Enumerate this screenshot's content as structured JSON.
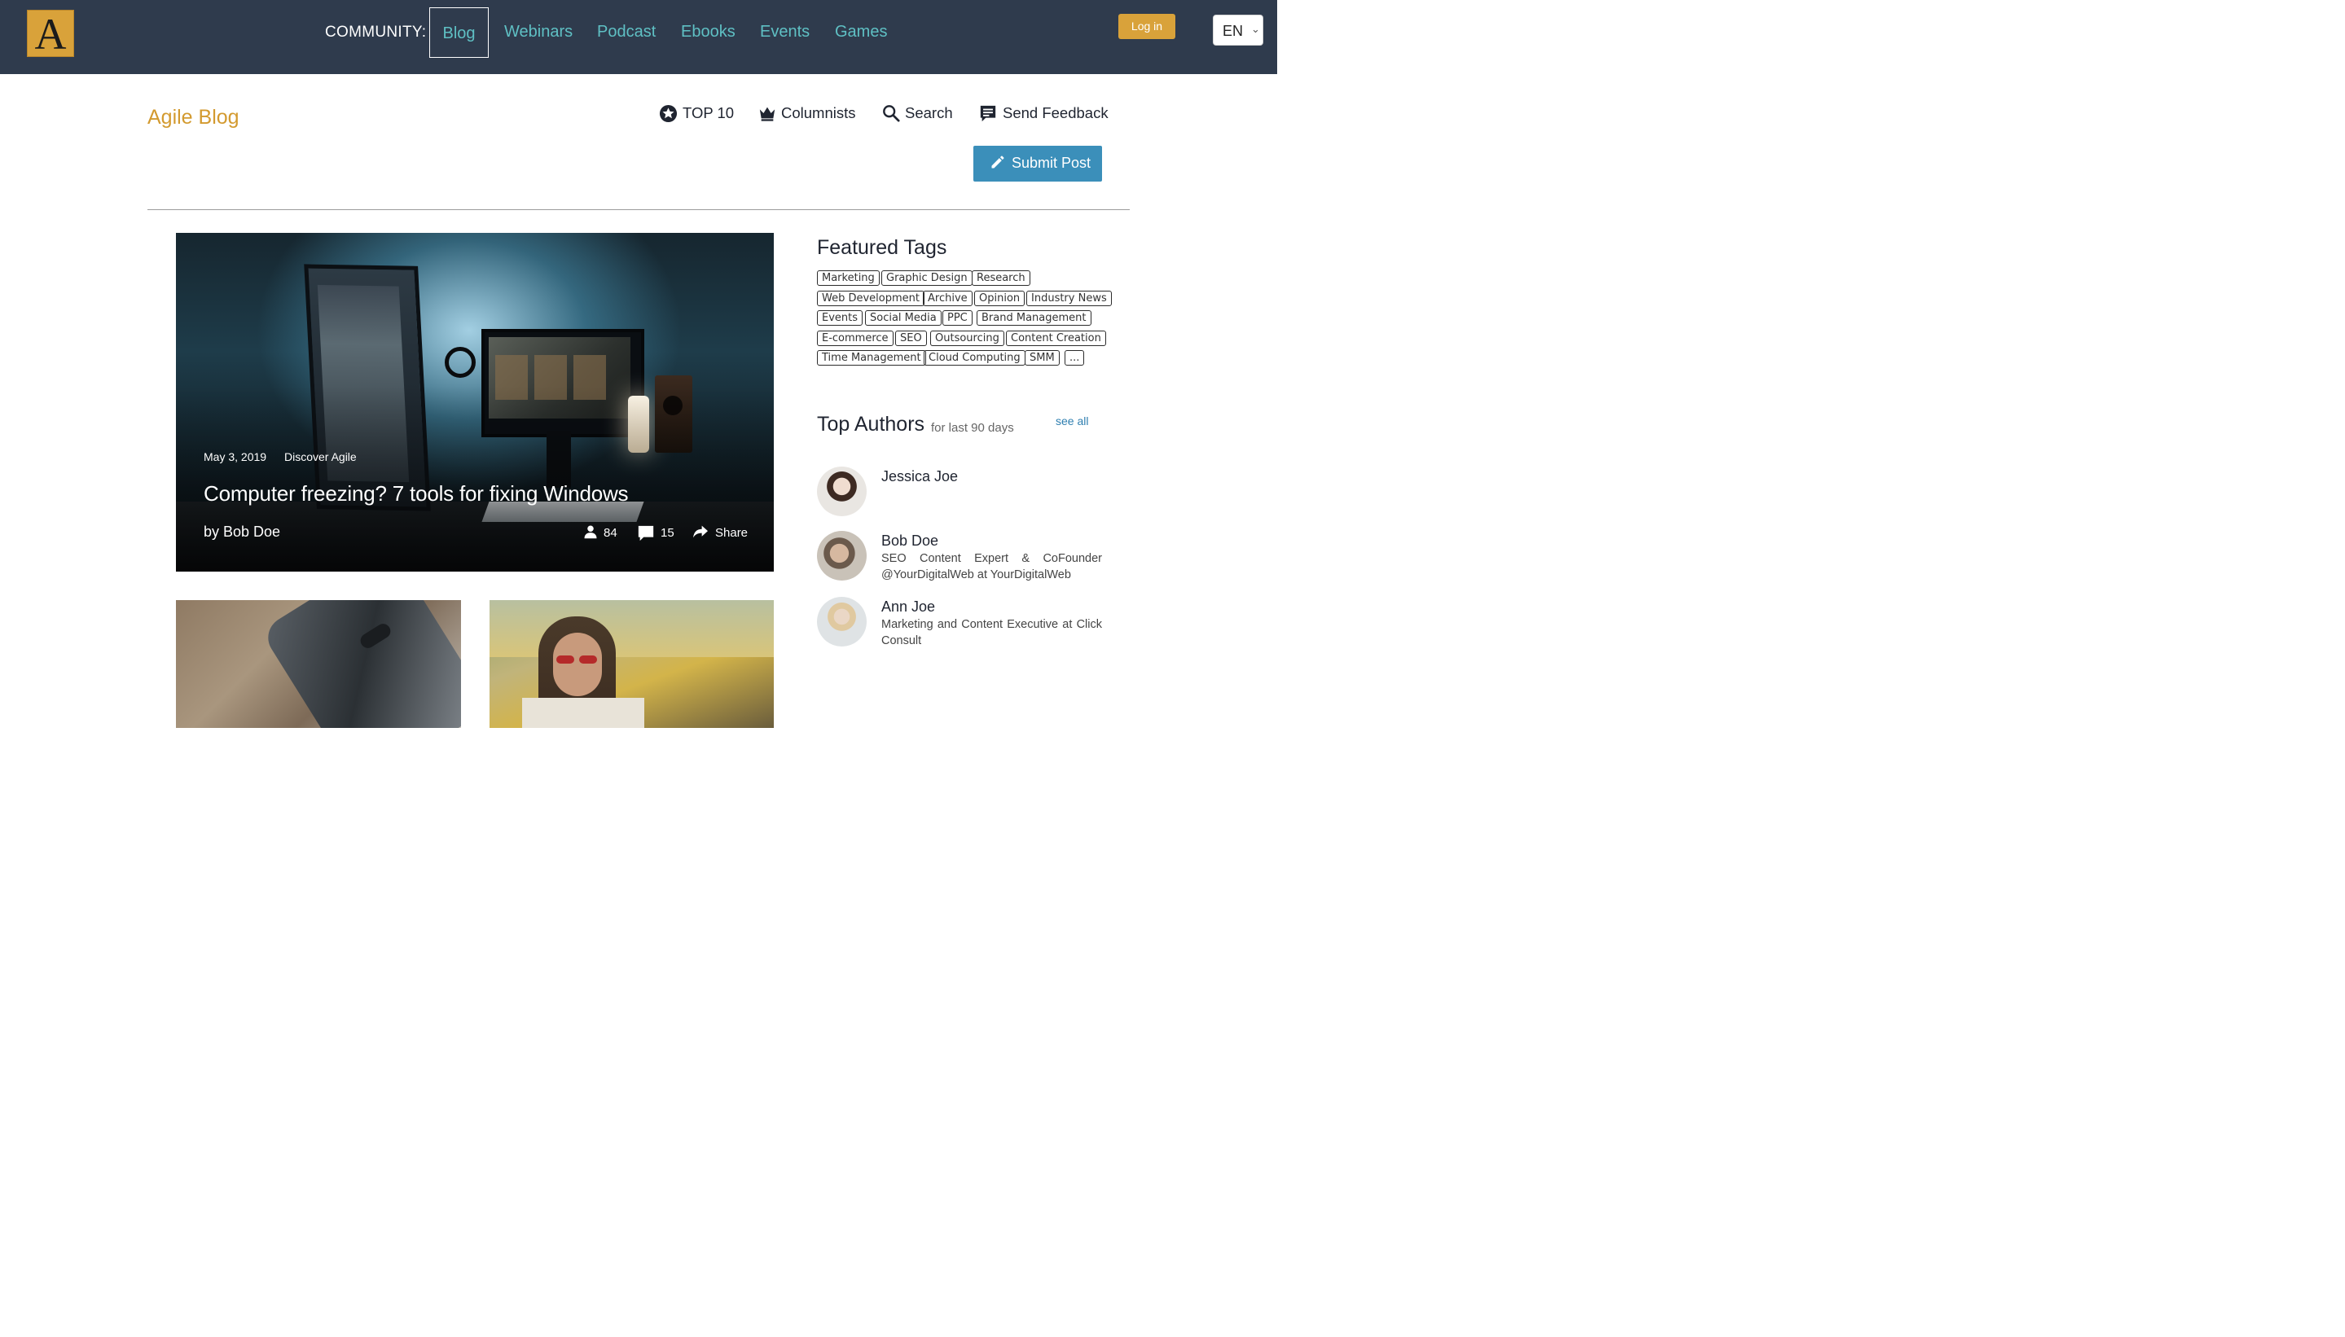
{
  "header": {
    "logo_letter": "A",
    "community_label": "COMMUNITY:",
    "nav": [
      "Blog",
      "Webinars",
      "Podcast",
      "Ebooks",
      "Events",
      "Games"
    ],
    "active_nav": "Blog",
    "login_label": "Log in",
    "language": "EN"
  },
  "blog": {
    "title": "Agile Blog",
    "tools": {
      "top10": "TOP 10",
      "columnists": "Columnists",
      "search": "Search",
      "feedback": "Send Feedback"
    },
    "submit_label": "Submit Post"
  },
  "featured_post": {
    "date": "May 3, 2019",
    "category": "Discover Agile",
    "title": "Computer freezing? 7 tools for fixing Windows",
    "author": "by Bob Doe",
    "views": "84",
    "comments": "15",
    "share_label": "Share"
  },
  "featured_tags": {
    "heading": "Featured Tags",
    "tags": [
      "Marketing",
      "Graphic Design",
      "Research",
      "Web Development",
      "Archive",
      "Opinion",
      "Industry News",
      "Events",
      "Social Media",
      "PPC",
      "Brand Management",
      "E-commerce",
      "SEO",
      "Outsourcing",
      "Content Creation",
      "Time Management",
      "Cloud Computing",
      "SMM",
      "..."
    ]
  },
  "top_authors": {
    "heading": "Top Authors",
    "subtitle": "for last 90 days",
    "see_all": "see all",
    "authors": [
      {
        "name": "Jessica Joe",
        "desc": ""
      },
      {
        "name": "Bob Doe",
        "desc": "SEO Content Expert & CoFounder @YourDigitalWeb at YourDigitalWeb"
      },
      {
        "name": "Ann Joe",
        "desc": "Marketing and Content Executive at Click Consult"
      }
    ]
  },
  "colors": {
    "header_bg": "#2f3b4d",
    "nav_link": "#5fc0c4",
    "accent_gold": "#d9a23a",
    "submit_blue": "#3b8fba"
  }
}
